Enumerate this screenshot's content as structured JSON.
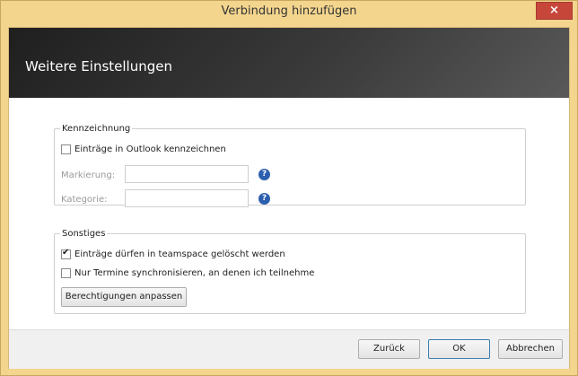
{
  "window": {
    "title": "Verbindung hinzufügen",
    "close_glyph": "×"
  },
  "header": {
    "title": "Weitere Einstellungen"
  },
  "kennzeichnung": {
    "legend": "Kennzeichnung",
    "checkbox_label": "Einträge in Outlook kennzeichnen",
    "checkbox_checked": false,
    "markierung_label": "Markierung:",
    "markierung_value": "",
    "kategorie_label": "Kategorie:",
    "kategorie_value": "",
    "help_glyph": "?"
  },
  "sonstiges": {
    "legend": "Sonstiges",
    "checkbox1_label": "Einträge dürfen in teamspace gelöscht werden",
    "checkbox1_checked": true,
    "checkbox2_label": "Nur Termine synchronisieren, an denen ich teilnehme",
    "checkbox2_checked": false,
    "permissions_button": "Berechtigungen anpassen"
  },
  "footer": {
    "back_button": "Zurück",
    "ok_button": "OK",
    "cancel_button": "Abbrechen"
  },
  "colors": {
    "window_frame": "#f3d58d",
    "close_button": "#c7463a",
    "help_icon": "#2c5fae"
  }
}
